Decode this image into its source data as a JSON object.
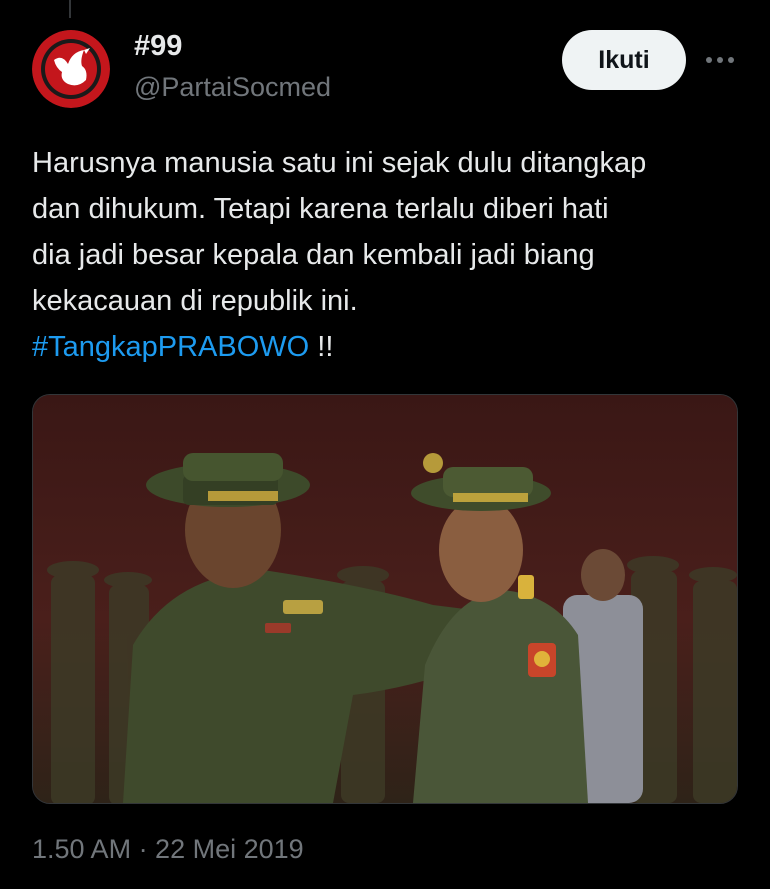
{
  "author": {
    "display_name": "#99",
    "handle": "@PartaiSocmed",
    "avatar_icon": "bird-logo-icon"
  },
  "actions": {
    "follow_label": "Ikuti",
    "more_icon": "more-options-icon"
  },
  "tweet": {
    "lines": [
      "Harusnya manusia satu ini sejak dulu ditangkap",
      "dan dihukum. Tetapi karena terlalu diberi hati",
      "dia jadi besar kepala dan kembali jadi biang",
      "kekacauan di republik ini."
    ],
    "hashtag": "#TangkapPRABOWO",
    "suffix": " !!"
  },
  "media": {
    "kind": "photo",
    "description_icon": "military-ceremony-photo"
  },
  "meta": {
    "timestamp": "1.50 AM · 22 Mei 2019"
  },
  "colors": {
    "background": "#000000",
    "text": "#e7e9ea",
    "muted": "#71767b",
    "link": "#1d9bf0",
    "follow_bg": "#eff3f4",
    "avatar_red": "#c4161c"
  }
}
